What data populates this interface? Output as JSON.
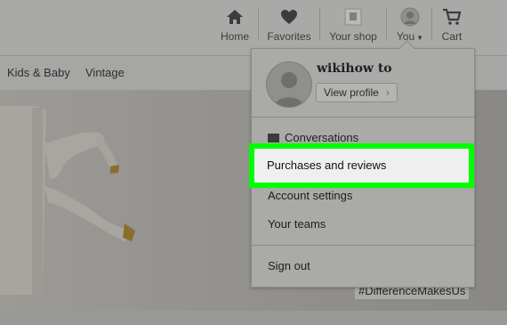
{
  "nav": {
    "home": "Home",
    "favorites": "Favorites",
    "shop": "Your shop",
    "you": "You",
    "cart": "Cart"
  },
  "categories": [
    "Kids & Baby",
    "Vintage"
  ],
  "hero": {
    "hashtag": "#DifferenceMakesUs"
  },
  "dropdown": {
    "username": "wikihow to",
    "view_profile": "View profile",
    "items": [
      "Conversations",
      "Purchases and reviews",
      "Account settings",
      "Your teams",
      "Sign out"
    ]
  },
  "colors": {
    "highlight": "#00ff00"
  }
}
